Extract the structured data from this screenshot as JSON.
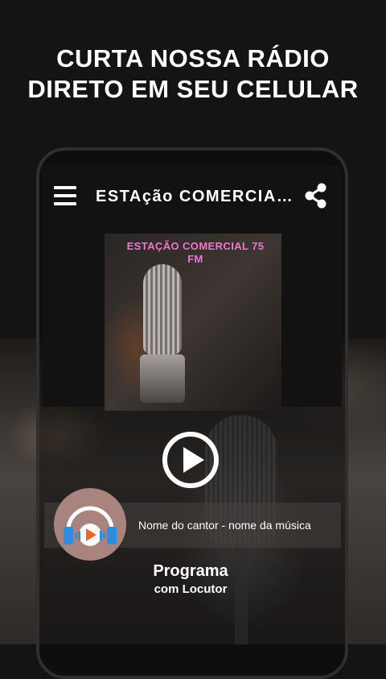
{
  "headline": {
    "line1": "CURTA NOSSA RÁDIO",
    "line2": "DIRETO EM SEU CELULAR"
  },
  "toolbar": {
    "menu_icon": "hamburger-menu-icon",
    "title": "ESTAção COMERCIAL...",
    "share_icon": "share-icon"
  },
  "cover": {
    "text_line1": "ESTAÇÃO COMERCIAL 75",
    "text_line2": "FM",
    "text_color": "#f076cf"
  },
  "player": {
    "play_icon": "play-icon",
    "track_info": "Nome do cantor - nome da música",
    "avatar_icon": "headphones-play-icon"
  },
  "program": {
    "title": "Programa",
    "subtitle": "com Locutor"
  },
  "colors": {
    "background": "#141414",
    "text": "#ffffff",
    "avatar_bg": "#a9847f",
    "headphone_blue": "#2e8de0",
    "play_orange": "#f0632a"
  }
}
